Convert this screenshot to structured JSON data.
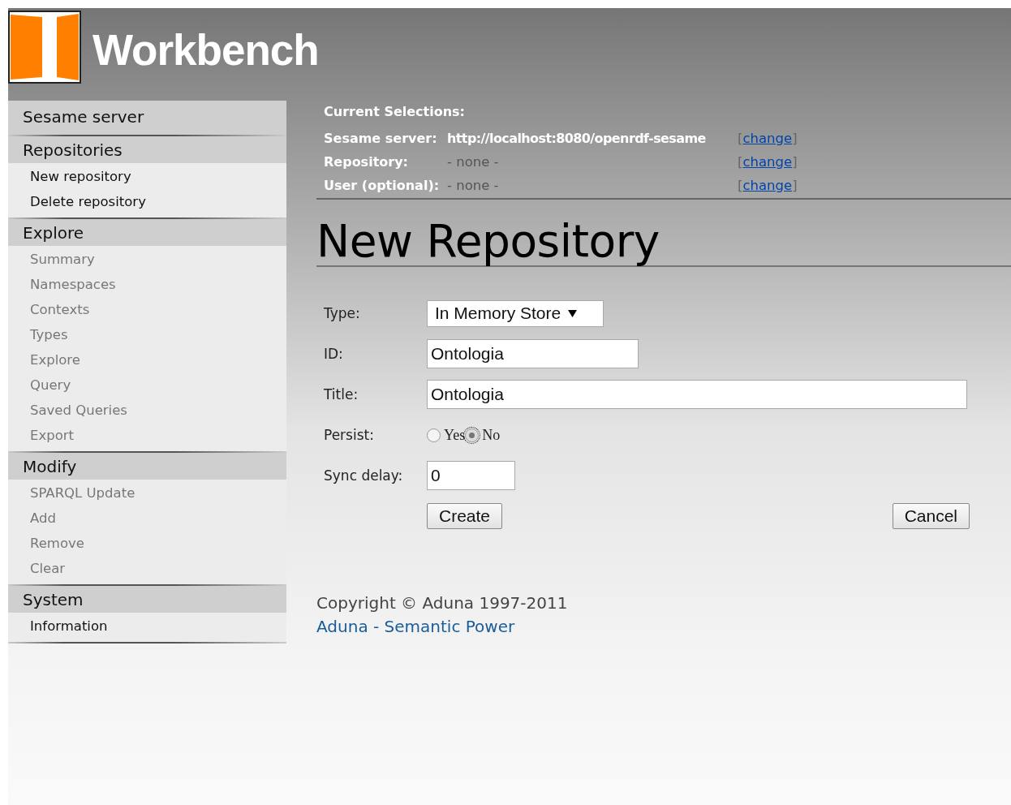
{
  "header": {
    "title": "Workbench"
  },
  "sidebar": {
    "sections": [
      {
        "title": "Sesame server"
      },
      {
        "title": "Repositories",
        "items": [
          {
            "label": "New repository",
            "disabled": false
          },
          {
            "label": "Delete repository",
            "disabled": false
          }
        ]
      },
      {
        "title": "Explore",
        "items": [
          {
            "label": "Summary",
            "disabled": true
          },
          {
            "label": "Namespaces",
            "disabled": true
          },
          {
            "label": "Contexts",
            "disabled": true
          },
          {
            "label": "Types",
            "disabled": true
          },
          {
            "label": "Explore",
            "disabled": true
          },
          {
            "label": "Query",
            "disabled": true
          },
          {
            "label": "Saved Queries",
            "disabled": true
          },
          {
            "label": "Export",
            "disabled": true
          }
        ]
      },
      {
        "title": "Modify",
        "items": [
          {
            "label": "SPARQL Update",
            "disabled": true
          },
          {
            "label": "Add",
            "disabled": true
          },
          {
            "label": "Remove",
            "disabled": true
          },
          {
            "label": "Clear",
            "disabled": true
          }
        ]
      },
      {
        "title": "System",
        "items": [
          {
            "label": "Information",
            "disabled": false
          }
        ]
      }
    ]
  },
  "selections": {
    "heading": "Current Selections:",
    "rows": [
      {
        "label": "Sesame server:",
        "value": "http://localhost:8080/openrdf-sesame",
        "kind": "set",
        "link": {
          "open": "[",
          "label": "change",
          "close": "]"
        }
      },
      {
        "label": "Repository:",
        "value": "- none -",
        "kind": "none",
        "link": {
          "open": "[",
          "label": "change",
          "close": "]"
        }
      },
      {
        "label": "User (optional):",
        "value": "- none -",
        "kind": "none",
        "link": {
          "open": "[",
          "label": "change",
          "close": "]"
        }
      }
    ]
  },
  "page_title": "New Repository",
  "form": {
    "fields": [
      {
        "kind": "select",
        "label": "Type:",
        "value": "In Memory Store"
      },
      {
        "kind": "text",
        "label": "ID:",
        "value": "Ontologia"
      },
      {
        "kind": "long-text",
        "label": "Title:",
        "value": "Ontologia"
      },
      {
        "kind": "radio",
        "label": "Persist:",
        "options": [
          {
            "label": "Yes",
            "selected": false,
            "focused": false
          },
          {
            "label": "No",
            "selected": true,
            "focused": true
          }
        ]
      },
      {
        "kind": "number",
        "label": "Sync delay:",
        "value": "0"
      }
    ],
    "buttons": [
      {
        "label": "Create"
      },
      {
        "label": "Cancel"
      }
    ]
  },
  "footer": {
    "copyright": "Copyright © Aduna 1997-2011",
    "link": "Aduna - Semantic Power"
  }
}
